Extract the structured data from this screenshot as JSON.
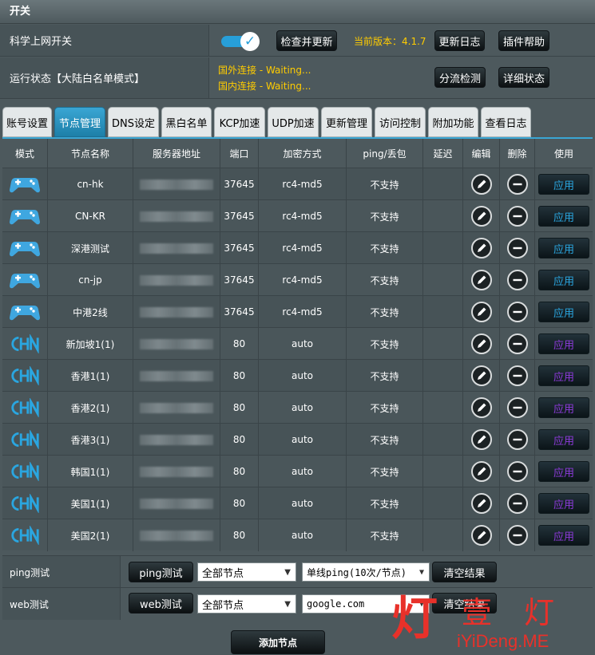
{
  "title": "开关",
  "switch_row": {
    "label": "科学上网开关",
    "enabled": true,
    "check_update_button": "检查并更新",
    "version_label": "当前版本：4.1.7",
    "changelog_button": "更新日志",
    "plugin_help_button": "插件帮助"
  },
  "status_row": {
    "label": "运行状态【大陆白名单模式】",
    "foreign_status": "国外连接 - Waiting...",
    "domestic_status": "国内连接 - Waiting...",
    "split_check_button": "分流检测",
    "detail_status_button": "详细状态"
  },
  "tabs": [
    {
      "label": "账号设置",
      "active": false
    },
    {
      "label": "节点管理",
      "active": true
    },
    {
      "label": "DNS设定",
      "active": false
    },
    {
      "label": "黑白名单",
      "active": false
    },
    {
      "label": "KCP加速",
      "active": false
    },
    {
      "label": "UDP加速",
      "active": false
    },
    {
      "label": "更新管理",
      "active": false
    },
    {
      "label": "访问控制",
      "active": false
    },
    {
      "label": "附加功能",
      "active": false
    },
    {
      "label": "查看日志",
      "active": false
    }
  ],
  "table": {
    "headers": [
      "模式",
      "节点名称",
      "服务器地址",
      "端口",
      "加密方式",
      "ping/丢包",
      "延迟",
      "编辑",
      "删除",
      "使用"
    ],
    "use_label": "应用",
    "rows": [
      {
        "mode": "game",
        "name": "cn-hk",
        "port": "37645",
        "method": "rc4-md5",
        "ping": "不支持"
      },
      {
        "mode": "game",
        "name": "CN-KR",
        "port": "37645",
        "method": "rc4-md5",
        "ping": "不支持"
      },
      {
        "mode": "game",
        "name": "深港测试",
        "port": "37645",
        "method": "rc4-md5",
        "ping": "不支持"
      },
      {
        "mode": "game",
        "name": "cn-jp",
        "port": "37645",
        "method": "rc4-md5",
        "ping": "不支持"
      },
      {
        "mode": "game",
        "name": "中港2线",
        "port": "37645",
        "method": "rc4-md5",
        "ping": "不支持"
      },
      {
        "mode": "chn",
        "name": "新加坡1(1)",
        "port": "80",
        "method": "auto",
        "ping": "不支持"
      },
      {
        "mode": "chn",
        "name": "香港1(1)",
        "port": "80",
        "method": "auto",
        "ping": "不支持"
      },
      {
        "mode": "chn",
        "name": "香港2(1)",
        "port": "80",
        "method": "auto",
        "ping": "不支持"
      },
      {
        "mode": "chn",
        "name": "香港3(1)",
        "port": "80",
        "method": "auto",
        "ping": "不支持"
      },
      {
        "mode": "chn",
        "name": "韩国1(1)",
        "port": "80",
        "method": "auto",
        "ping": "不支持"
      },
      {
        "mode": "chn",
        "name": "美国1(1)",
        "port": "80",
        "method": "auto",
        "ping": "不支持"
      },
      {
        "mode": "chn",
        "name": "美国2(1)",
        "port": "80",
        "method": "auto",
        "ping": "不支持"
      }
    ]
  },
  "ping_test": {
    "label": "ping测试",
    "button": "ping测试",
    "node_select": "全部节点",
    "method_select": "单线ping(10次/节点)",
    "clear_button": "清空结果"
  },
  "web_test": {
    "label": "web测试",
    "button": "web测试",
    "node_select": "全部节点",
    "target_select": "google.com",
    "clear_button": "清空结果"
  },
  "add_node_button": "添加节点",
  "watermark": {
    "big_left": "灯",
    "big_mid": "壹",
    "big_right": "灯",
    "url": "iYiDeng.ME"
  }
}
